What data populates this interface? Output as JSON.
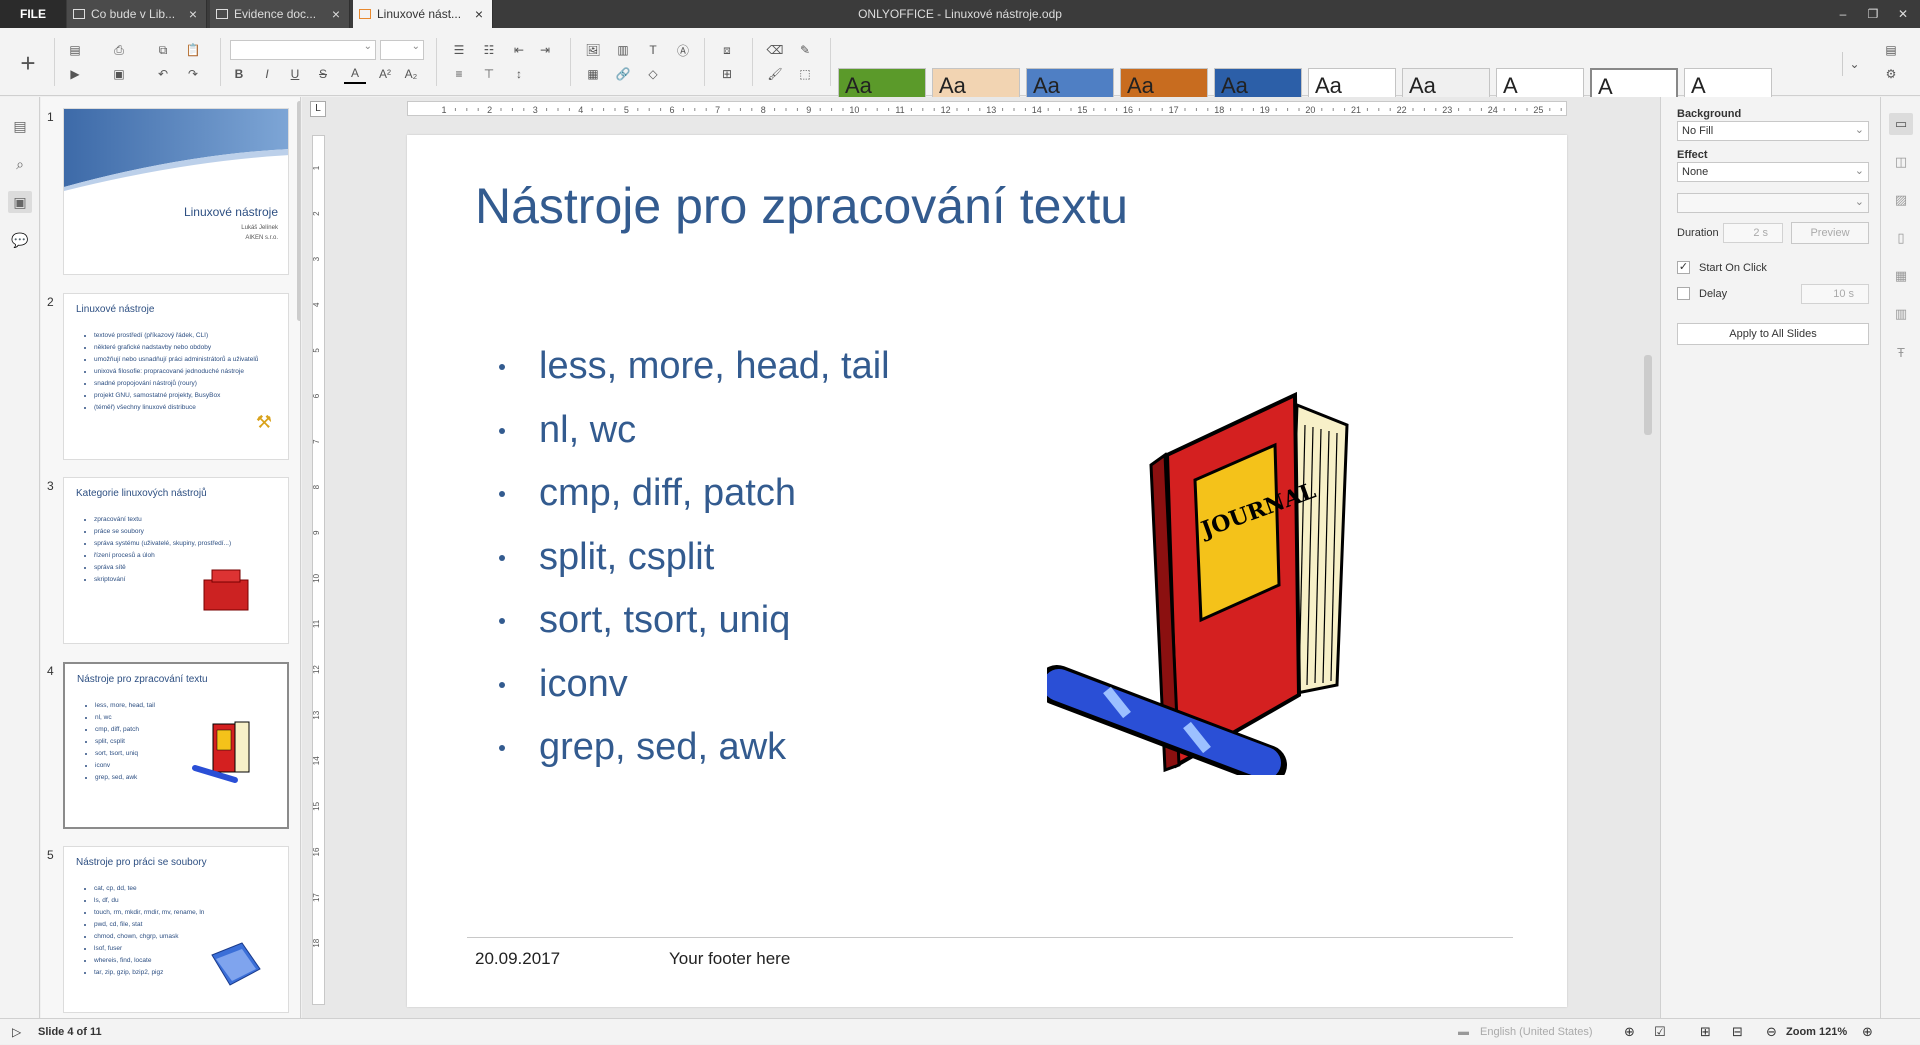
{
  "titlebar": {
    "file_label": "FILE",
    "tabs": [
      {
        "label": "Co bude v Lib..."
      },
      {
        "label": "Evidence doc..."
      },
      {
        "label": "Linuxové nást..."
      }
    ],
    "window_title": "ONLYOFFICE - Linuxové nástroje.odp",
    "close_glyph": "×",
    "minimize_glyph": "–",
    "maximize_glyph": "❐",
    "window_close_glyph": "✕"
  },
  "themes": {
    "label": "Aa",
    "letter": "A",
    "items": [
      {
        "name": "green",
        "bg": "#5b9a2a"
      },
      {
        "name": "beige",
        "bg": "#f2d4b2"
      },
      {
        "name": "blue-wave",
        "bg": "#4f7fc4"
      },
      {
        "name": "orange",
        "bg": "#c86c1f"
      },
      {
        "name": "blue-dots",
        "bg": "#2c5fa8"
      },
      {
        "name": "white-swoosh",
        "bg": "#ffffff"
      },
      {
        "name": "gray-swoosh",
        "bg": "#f0f0f0"
      },
      {
        "name": "blue-corner",
        "bg": "#ffffff"
      },
      {
        "name": "plain",
        "bg": "#ffffff"
      },
      {
        "name": "blank",
        "bg": "#ffffff"
      }
    ]
  },
  "thumbnails": [
    {
      "num": "1",
      "title": "Linuxové nástroje",
      "author": "Lukáš Jelínek",
      "company": "AIKEN s.r.o."
    },
    {
      "num": "2",
      "title": "Linuxové nástroje",
      "items": [
        "textové prostředí (příkazový řádek, CLI)",
        "některé grafické nadstavby nebo obdoby",
        "umožňují nebo usnadňují práci administrátorů a uživatelů",
        "unixová filosofie: propracované jednoduché nástroje",
        "snadné propojování nástrojů (roury)",
        "projekt GNU, samostatné projekty, BusyBox",
        "(téměř) všechny linuxové distribuce"
      ]
    },
    {
      "num": "3",
      "title": "Kategorie linuxových nástrojů",
      "items": [
        "zpracování textu",
        "práce se soubory",
        "správa systému (uživatelé, skupiny, prostředí...)",
        "řízení procesů a úloh",
        "správa sítě",
        "skriptování"
      ]
    },
    {
      "num": "4",
      "title": "Nástroje pro zpracování textu",
      "items": [
        "less, more, head, tail",
        "nl, wc",
        "cmp, diff, patch",
        "split, csplit",
        "sort, tsort, uniq",
        "iconv",
        "grep, sed, awk"
      ]
    },
    {
      "num": "5",
      "title": "Nástroje pro práci se soubory",
      "items": [
        "cat, cp, dd, tee",
        "ls, df, du",
        "touch, rm, mkdir, rmdir, mv, rename, ln",
        "pwd, cd, file, stat",
        "chmod, chown, chgrp, umask",
        "lsof, fuser",
        "whereis, find, locate",
        "tar, zip, gzip, bzip2, pigz"
      ]
    }
  ],
  "slide": {
    "title": "Nástroje pro zpracování textu",
    "bullets": [
      "less, more, head, tail",
      "nl, wc",
      "cmp, diff, patch",
      "split, csplit",
      "sort, tsort, uniq",
      "iconv",
      "grep, sed, awk"
    ],
    "footer_date": "20.09.2017",
    "footer_text": "Your footer here",
    "image_label": "JOURNAL"
  },
  "ruler": {
    "corner": "L",
    "h_ticks": [
      "1",
      "2",
      "3",
      "4",
      "5",
      "6",
      "7",
      "8",
      "9",
      "10",
      "11",
      "12",
      "13",
      "14",
      "15",
      "16",
      "17",
      "18",
      "19",
      "20",
      "21",
      "22",
      "23",
      "24",
      "25"
    ],
    "v_ticks": [
      "1",
      "2",
      "3",
      "4",
      "5",
      "6",
      "7",
      "8",
      "9",
      "10",
      "11",
      "12",
      "13",
      "14",
      "15",
      "16",
      "17",
      "18"
    ]
  },
  "rightpanel": {
    "background_label": "Background",
    "background_value": "No Fill",
    "effect_label": "Effect",
    "effect_value": "None",
    "effect_sub_value": "",
    "duration_label": "Duration",
    "duration_value": "2 s",
    "preview_label": "Preview",
    "start_on_click_label": "Start On Click",
    "delay_label": "Delay",
    "delay_value": "10 s",
    "apply_all_label": "Apply to All Slides"
  },
  "statusbar": {
    "slide_info": "Slide 4 of 11",
    "language": "English (United States)",
    "zoom_label": "Zoom 121%"
  },
  "colors": {
    "accent_blue": "#335b8f",
    "tab_active_icon": "#e8892e"
  }
}
